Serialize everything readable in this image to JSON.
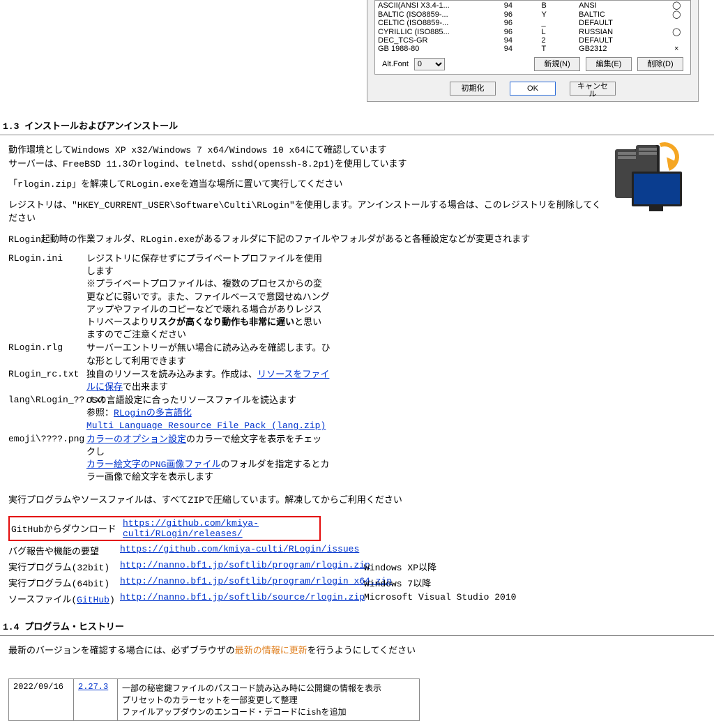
{
  "dialog": {
    "encodings": [
      {
        "name": "ASCII(ANSI X3.4-1...",
        "col1": "94",
        "col2": "B",
        "set": "ANSI",
        "mark": "◯"
      },
      {
        "name": "BALTIC (ISO8859-...",
        "col1": "96",
        "col2": "Y",
        "set": "BALTIC",
        "mark": "◯"
      },
      {
        "name": "CELTIC (ISO8859-...",
        "col1": "96",
        "col2": "_",
        "set": "DEFAULT",
        "mark": ""
      },
      {
        "name": "CYRILLIC (ISO885...",
        "col1": "96",
        "col2": "L",
        "set": "RUSSIAN",
        "mark": "◯"
      },
      {
        "name": "DEC_TCS-GR",
        "col1": "94",
        "col2": "2",
        "set": "DEFAULT",
        "mark": ""
      },
      {
        "name": "GB 1988-80",
        "col1": "94",
        "col2": "T",
        "set": "GB2312",
        "mark": "×"
      }
    ],
    "altfont_label": "Alt.Font",
    "altfont_value": "0",
    "btn_new": "新規(N)",
    "btn_edit": "編集(E)",
    "btn_delete": "削除(D)",
    "btn_init": "初期化",
    "btn_ok": "OK",
    "btn_cancel": "キャンセル"
  },
  "section13": {
    "title": "1.3  インストールおよびアンインストール",
    "p1": "動作環境としてWindows XP x32/Windows 7 x64/Windows 10 x64にて確認しています\nサーバーは、FreeBSD 11.3のrlogind、telnetd、sshd(openssh-8.2p1)を使用しています",
    "p2": "「rlogin.zip」を解凍してRLogin.exeを適当な場所に置いて実行してください",
    "p3": "レジストリは、\"HKEY_CURRENT_USER\\Software\\Culti\\RLogin\"を使用します。アンインストールする場合は、このレジストリを削除してください",
    "p4": "RLogin起動時の作業フォルダ、RLogin.exeがあるフォルダに下記のファイルやフォルダがあると各種設定などが変更されます",
    "files": [
      {
        "name": "RLogin.ini",
        "desc_pre": "レジストリに保存せずにプライベートプロファイルを使用します\n※プライベートプロファイルは、複数のプロセスからの変更などに弱いです。また、ファイルベースで意図せぬハングアップやファイルのコピーなどで壊れる場合がありレジストリベースより",
        "desc_bold": "リスクが高くなり動作も非常に遅い",
        "desc_post": "と思いますのでご注意ください"
      },
      {
        "name": "RLogin.rlg",
        "desc_pre": "サーバーエントリーが無い場合に読み込みを確認します。ひな形として利用できます",
        "desc_bold": "",
        "desc_post": ""
      },
      {
        "name": "RLogin_rc.txt",
        "desc_pre": "独自のリソースを読み込みます。作成は、",
        "link": "リソースをファイルに保存",
        "desc_post": "で出来ます"
      },
      {
        "name": "lang\\RLogin_??.txt",
        "desc_pre": "OSの言語設定に合ったリソースファイルを読込ます\n参照：",
        "link": "RLoginの多言語化",
        "link2": "Multi Language Resource File Pack (lang.zip)"
      },
      {
        "name": "emoji\\????.png",
        "link": "カラーのオプション設定",
        "mid1": "のカラーで絵文字を表示をチェックし",
        "link2": "カラー絵文字のPNG画像ファイル",
        "desc_post": "のフォルダを指定するとカラー画像で絵文字を表示します"
      }
    ],
    "zip_note": "実行プログラムやソースファイルは、すべてZIPで圧縮しています。解凍してからご利用ください",
    "downloads": [
      {
        "label": "GitHubからダウンロード",
        "url": "https://github.com/kmiya-culti/RLogin/releases/",
        "note": "",
        "highlight": true
      },
      {
        "label": "バグ報告や機能の要望",
        "url": "https://github.com/kmiya-culti/RLogin/issues",
        "note": ""
      },
      {
        "label": "実行プログラム(32bit)",
        "url": "http://nanno.bf1.jp/softlib/program/rlogin.zip",
        "note": "Windows XP以降"
      },
      {
        "label": "実行プログラム(64bit)",
        "url": "http://nanno.bf1.jp/softlib/program/rlogin_x64.zip",
        "note": "Windows 7以降"
      },
      {
        "label_pre": "ソースファイル(",
        "label_link": "GitHub",
        "label_post": ")",
        "url": "http://nanno.bf1.jp/softlib/source/rlogin.zip",
        "note": "Microsoft Visual Studio 2010"
      }
    ]
  },
  "section14": {
    "title": "1.4  プログラム・ヒストリー",
    "note_pre": "最新のバージョンを確認する場合には、必ずブラウザの",
    "note_em": "最新の情報に更新",
    "note_post": "を行うようにしてください",
    "history": [
      {
        "date": "2022/09/16",
        "ver": "2.27.3",
        "lines": "一部の秘密鍵ファイルのパスコード読み込み時に公開鍵の情報を表示\nプリセットのカラーセットを一部変更して整理\nファイルアップダウンのエンコード・デコードにishを追加"
      }
    ]
  }
}
